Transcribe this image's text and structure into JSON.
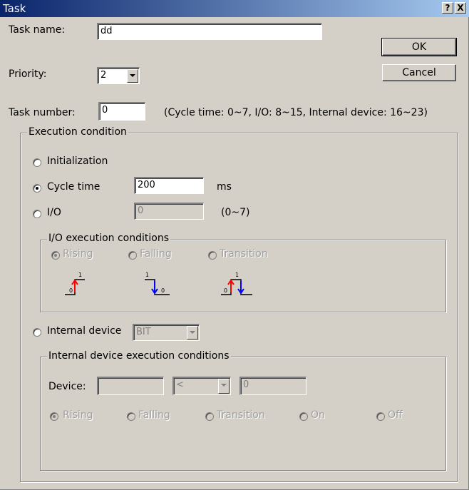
{
  "window": {
    "title": "Task",
    "help_button": "?",
    "close_button": "X"
  },
  "task_name": {
    "label": "Task name:",
    "value": "dd"
  },
  "priority": {
    "label": "Priority:",
    "value": "2"
  },
  "task_number": {
    "label": "Task number:",
    "value": "0",
    "hint": "(Cycle time: 0~7, I/O: 8~15, Internal device: 16~23)"
  },
  "buttons": {
    "ok": "OK",
    "cancel": "Cancel"
  },
  "execution": {
    "group_label": "Execution condition",
    "initialization": "Initialization",
    "cycle_time": {
      "label": "Cycle time",
      "value": "200",
      "unit": "ms"
    },
    "io": {
      "label": "I/O",
      "value": "0",
      "range": "(0~7)"
    },
    "selected": "cycle_time"
  },
  "io_conditions": {
    "group_label": "I/O execution conditions",
    "rising": "Rising",
    "falling": "Falling",
    "transition": "Transition",
    "icon_high": "1",
    "icon_low": "0"
  },
  "internal_device": {
    "label": "Internal device",
    "type_value": "BIT",
    "group_label": "Internal device execution conditions",
    "device_label": "Device:",
    "device_value": "",
    "operator_value": "<",
    "compare_value": "0",
    "rising": "Rising",
    "falling": "Falling",
    "transition": "Transition",
    "on": "On",
    "off": "Off"
  },
  "colors": {
    "rising": "#ff0000",
    "falling": "#0000ff",
    "titlebar": "#0a246a"
  }
}
